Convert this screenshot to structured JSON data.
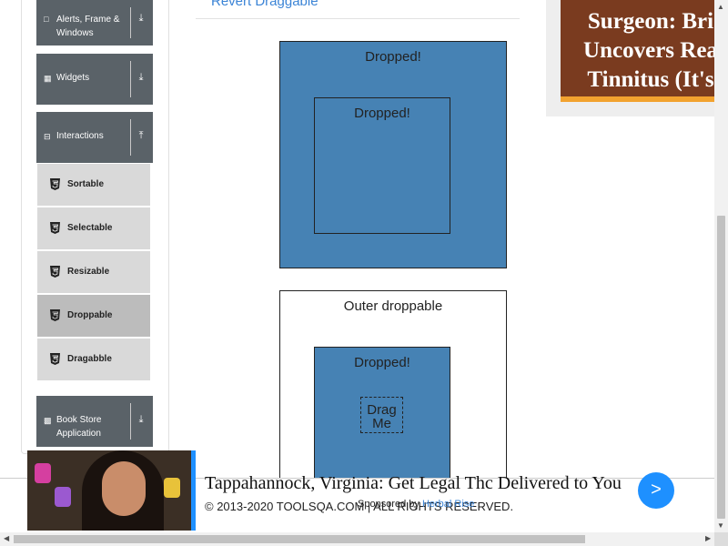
{
  "sidebar": {
    "groups": [
      {
        "label": "Alerts, Frame & Windows",
        "icon": "window-icon",
        "arrow": "download-arrow-icon"
      },
      {
        "label": "Widgets",
        "icon": "grid-icon",
        "arrow": "download-arrow-icon"
      },
      {
        "label": "Interactions",
        "icon": "collapse-square-icon",
        "arrow": "upload-arrow-icon"
      },
      {
        "label": "Book Store Application",
        "icon": "chart-icon",
        "arrow": "download-arrow-icon"
      }
    ],
    "items": [
      {
        "label": "Sortable"
      },
      {
        "label": "Selectable"
      },
      {
        "label": "Resizable"
      },
      {
        "label": "Droppable",
        "active": true
      },
      {
        "label": "Dragabble"
      }
    ]
  },
  "main": {
    "revert_link": "Revert Draggable",
    "top_outer": {
      "text": "Dropped!",
      "color": "#4682b4"
    },
    "top_inner": {
      "text": "Dropped!"
    },
    "bottom_outer": {
      "text": "Outer droppable"
    },
    "bottom_inner": {
      "text": "Dropped!",
      "color": "#4682b4"
    },
    "drag_box": {
      "text": "Drag Me"
    }
  },
  "ads": {
    "top": {
      "text": "Surgeon: Bri Uncovers Rea Tinnitus (It's"
    },
    "bottom": {
      "headline": "Tappahannock, Virginia: Get Legal Thc Delivered to You",
      "sponsor_prefix": "Sponsored by",
      "sponsor_name": "Herbal Rise",
      "button": ">"
    }
  },
  "footer": {
    "copyright": "© 2013-2020 TOOLSQA.COM | ALL RIGHTS RESERVED."
  }
}
